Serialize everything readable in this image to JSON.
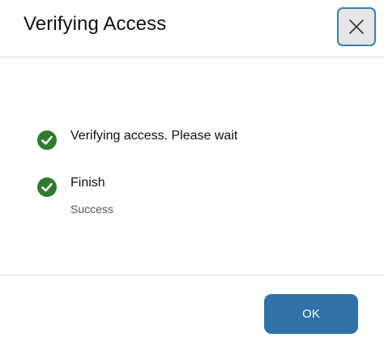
{
  "dialog": {
    "title": "Verifying Access",
    "close_icon": "close-icon"
  },
  "steps": [
    {
      "label": "Verifying access. Please wait",
      "status_icon": "check-circle-icon",
      "status_color": "#2f7a2f"
    },
    {
      "label": "Finish",
      "sublabel": "Success",
      "status_icon": "check-circle-icon",
      "status_color": "#2f7a2f"
    }
  ],
  "footer": {
    "ok_label": "OK"
  },
  "colors": {
    "accent": "#2f71a8",
    "success": "#2f7a2f",
    "close_border": "#3d7fb3"
  }
}
